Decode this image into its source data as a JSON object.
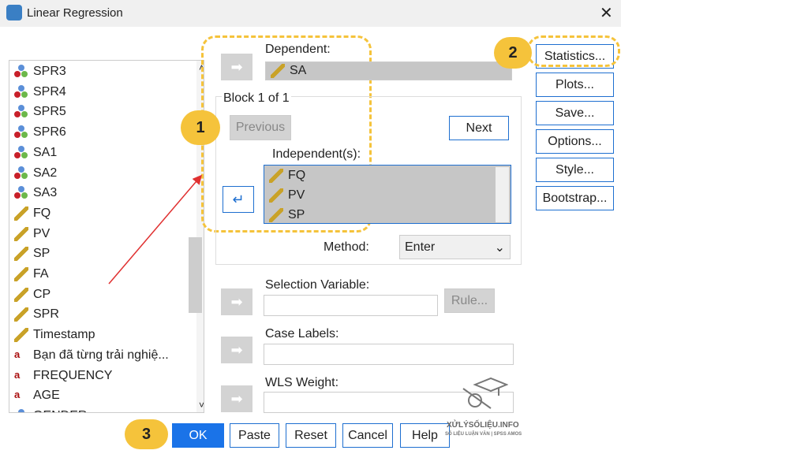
{
  "window": {
    "title": "Linear Regression",
    "close": "✕"
  },
  "variables": [
    {
      "name": "SPR3",
      "type": "nominal"
    },
    {
      "name": "SPR4",
      "type": "nominal"
    },
    {
      "name": "SPR5",
      "type": "nominal"
    },
    {
      "name": "SPR6",
      "type": "nominal"
    },
    {
      "name": "SA1",
      "type": "nominal"
    },
    {
      "name": "SA2",
      "type": "nominal"
    },
    {
      "name": "SA3",
      "type": "nominal"
    },
    {
      "name": "FQ",
      "type": "scale"
    },
    {
      "name": "PV",
      "type": "scale"
    },
    {
      "name": "SP",
      "type": "scale"
    },
    {
      "name": "FA",
      "type": "scale"
    },
    {
      "name": "CP",
      "type": "scale"
    },
    {
      "name": "SPR",
      "type": "scale"
    },
    {
      "name": "Timestamp",
      "type": "scale-date"
    },
    {
      "name": "Bạn đã từng trải nghiệ...",
      "type": "string"
    },
    {
      "name": "FREQUENCY",
      "type": "string"
    },
    {
      "name": "AGE",
      "type": "string"
    },
    {
      "name": "GENDER",
      "type": "nominal"
    }
  ],
  "dependent": {
    "label": "Dependent:",
    "value": "SA"
  },
  "block": {
    "label": "Block 1 of 1",
    "previous": "Previous",
    "next": "Next"
  },
  "independents": {
    "label": "Independent(s):",
    "values": [
      "FQ",
      "PV",
      "SP"
    ]
  },
  "method": {
    "label": "Method:",
    "value": "Enter"
  },
  "selection": {
    "label": "Selection Variable:",
    "rule": "Rule..."
  },
  "case_labels": {
    "label": "Case Labels:"
  },
  "wls": {
    "label": "WLS Weight:"
  },
  "side_buttons": [
    "Statistics...",
    "Plots...",
    "Save...",
    "Options...",
    "Style...",
    "Bootstrap..."
  ],
  "bottom_buttons": {
    "ok": "OK",
    "paste": "Paste",
    "reset": "Reset",
    "cancel": "Cancel",
    "help": "Help"
  },
  "annotations": {
    "step1": "1",
    "step2": "2",
    "step3": "3",
    "accent": "#f5c33b"
  },
  "watermark": {
    "brand": "XỬLÝSỐLIỆU.INFO",
    "tagline": "SỐ LIỆU LUẬN VĂN | SPSS AMOS"
  }
}
